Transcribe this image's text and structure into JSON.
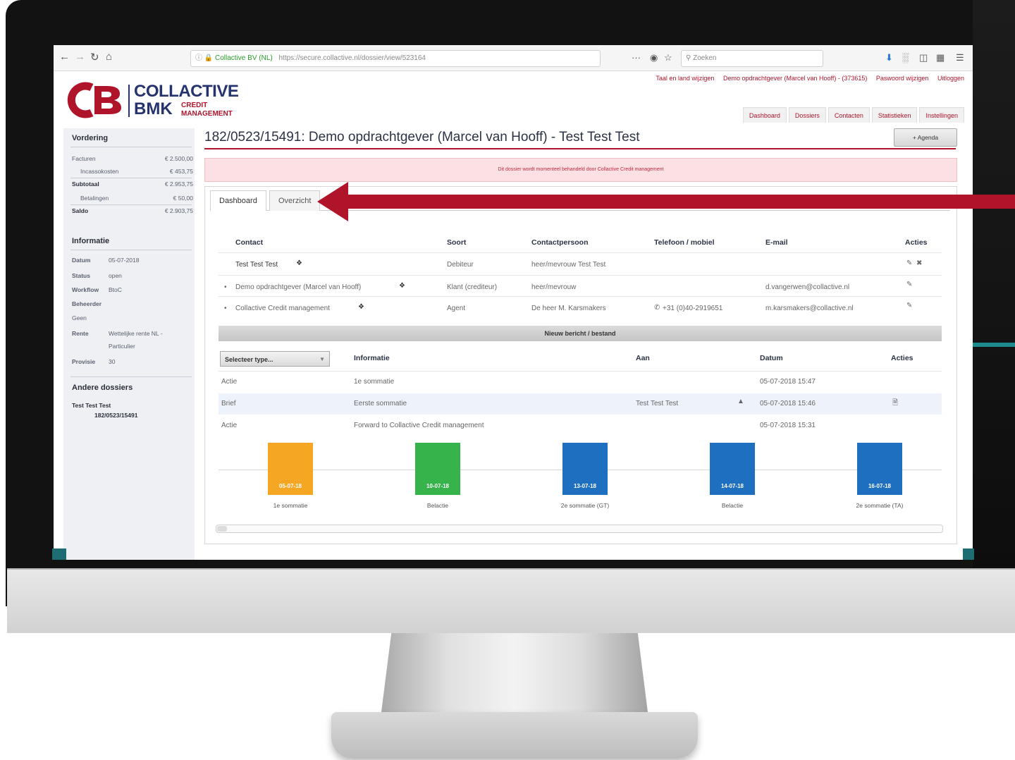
{
  "browser": {
    "site_identity": "Collactive BV (NL)",
    "url": "https://secure.collactive.nl/dossier/view/523164",
    "search_placeholder": "Zoeken",
    "nav_icons": [
      "back-icon",
      "forward-icon",
      "reload-icon",
      "home-icon"
    ],
    "toolbar_icons": [
      "download-icon",
      "library-icon",
      "sidebar-icon",
      "reader-icon",
      "menu-icon"
    ]
  },
  "header": {
    "top_links": [
      "Taal en land wijzigen",
      "Demo opdrachtgever (Marcel van Hooff) - (373615)",
      "Paswoord wijzigen",
      "Uitloggen"
    ],
    "logo": {
      "monogram": "CB",
      "line1": "COLLACTIVE",
      "line2": "BMK",
      "sub1": "CREDIT",
      "sub2": "MANAGEMENT"
    },
    "nav": [
      "Dashboard",
      "Dossiers",
      "Contacten",
      "Statistieken",
      "Instellingen"
    ]
  },
  "sidebar": {
    "vordering": {
      "heading": "Vordering",
      "rows": [
        {
          "label": "Facturen",
          "value": "€ 2.500,00"
        },
        {
          "label": "Incassokosten",
          "value": "€ 453,75"
        },
        {
          "label": "Subtotaal",
          "value": "€ 2.953,75"
        },
        {
          "label": "Betalingen",
          "value": "€ 50,00"
        },
        {
          "label": "Saldo",
          "value": "€ 2.903,75"
        }
      ]
    },
    "informatie": {
      "heading": "Informatie",
      "datum_label": "Datum",
      "datum_value": "05-07-2018",
      "status_label": "Status",
      "status_value": "open",
      "workflow_label": "Workflow",
      "workflow_value": "BtoC",
      "beheerder_label": "Beheerder",
      "beheerder_value": "Geen",
      "rente_label": "Rente",
      "rente_value_1": "Wettelijke rente NL -",
      "rente_value_2": "Particulier",
      "provisie_label": "Provisie",
      "provisie_value": "30"
    },
    "andere": {
      "heading": "Andere dossiers",
      "item_name": "Test Test Test",
      "item_number": "182/0523/15491"
    }
  },
  "main": {
    "title": "182/0523/15491: Demo opdrachtgever (Marcel van Hooff) - Test Test Test",
    "agenda_button": "+ Agenda",
    "alert": "Dit dossier wordt momenteel behandeld door Collactive Credit management",
    "tabs": [
      "Dashboard",
      "Overzicht"
    ],
    "contacts": {
      "headers": [
        "Contact",
        "Soort",
        "Contactpersoon",
        "Telefoon / mobiel",
        "E-mail",
        "Acties"
      ],
      "rows": [
        {
          "contact": "Test Test Test",
          "soort": "Debiteur",
          "persoon": "heer/mevrouw Test Test",
          "telefoon": "",
          "email": ""
        },
        {
          "contact": "Demo opdrachtgever (Marcel van Hooff)",
          "soort": "Klant (crediteur)",
          "persoon": "heer/mevrouw",
          "telefoon": "",
          "email": "d.vangerwen@collactive.nl"
        },
        {
          "contact": "Collactive Credit management",
          "soort": "Agent",
          "persoon": "De heer M. Karsmakers",
          "telefoon": "+31 (0)40-2919651",
          "email": "m.karsmakers@collactive.nl"
        }
      ]
    },
    "message_bar": "Nieuw bericht / bestand",
    "messages": {
      "select_label": "Selecteer type...",
      "headers": [
        "Informatie",
        "Aan",
        "Datum",
        "Acties"
      ],
      "rows": [
        {
          "type": "Actie",
          "info": "1e sommatie",
          "aan": "",
          "datum": "05-07-2018 15:47"
        },
        {
          "type": "Brief",
          "info": "Eerste sommatie",
          "aan": "Test Test Test",
          "datum": "05-07-2018 15:46"
        },
        {
          "type": "Actie",
          "info": "Forward to Collactive Credit management",
          "aan": "",
          "datum": "05-07-2018 15:31"
        }
      ]
    },
    "timeline": [
      {
        "date": "05-07-18",
        "label": "1e sommatie",
        "color": "#f5a623"
      },
      {
        "date": "10-07-18",
        "label": "Belactie",
        "color": "#36b34a"
      },
      {
        "date": "13-07-18",
        "label": "2e sommatie (GT)",
        "color": "#1f6fc0"
      },
      {
        "date": "14-07-18",
        "label": "Belactie",
        "color": "#1f6fc0"
      },
      {
        "date": "16-07-18",
        "label": "2e sommatie (TA)",
        "color": "#1f6fc0"
      }
    ]
  },
  "colors": {
    "brand_red": "#b0142b",
    "brand_navy": "#25346d"
  }
}
